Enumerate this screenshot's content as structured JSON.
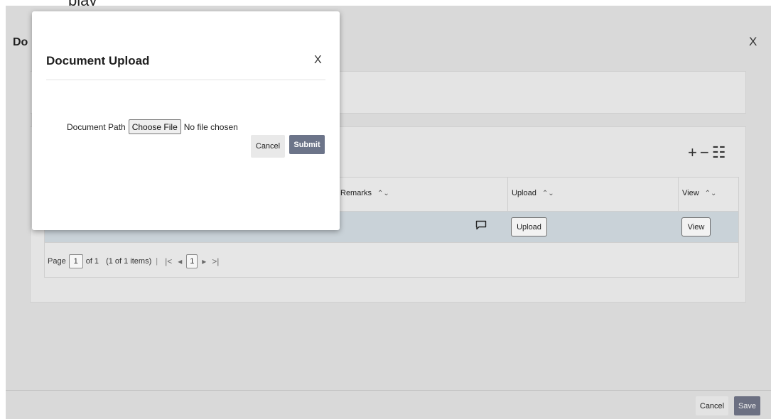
{
  "top_strip": {
    "partial_text": "play"
  },
  "background": {
    "title": "Do",
    "close_label": "X",
    "grid_tools": {
      "add": "+",
      "remove": "−",
      "columns": "☷"
    },
    "grid": {
      "columns": [
        {
          "label": "Remarks",
          "sort_icon": "⌃⌄"
        },
        {
          "label": "Upload",
          "sort_icon": "⌃⌄"
        },
        {
          "label": "View",
          "sort_icon": "⌃⌄"
        }
      ],
      "row": {
        "upload_button": "Upload",
        "view_button": "View"
      },
      "pager": {
        "page_label": "Page",
        "page_value": "1",
        "of_label": "of 1",
        "items_label": "(1 of 1 items)",
        "first": "|<",
        "prev": "◂",
        "current": "1",
        "next": "▸",
        "last": ">|"
      }
    },
    "footer": {
      "cancel": "Cancel",
      "save": "Save"
    }
  },
  "modal": {
    "title": "Document Upload",
    "close_label": "X",
    "document_path_label": "Document Path",
    "choose_file_label": "Choose File",
    "file_status": "No file chosen",
    "cancel_label": "Cancel",
    "submit_label": "Submit"
  },
  "colors": {
    "overlay": "#d9d9d9",
    "selected_row": "#c9d2d8",
    "submit_button": "#6c7489",
    "save_button": "#6c7082"
  }
}
